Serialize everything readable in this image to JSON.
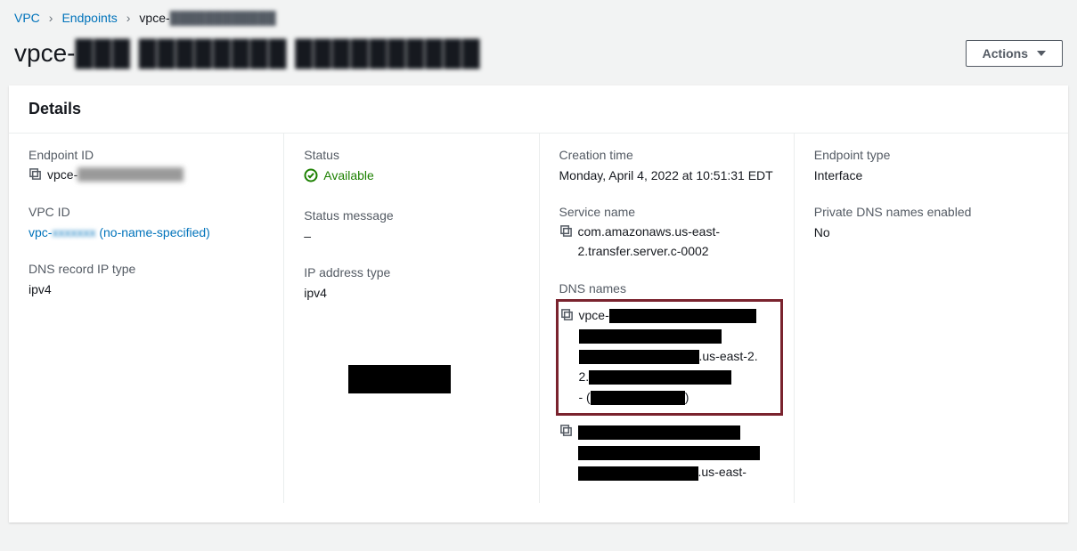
{
  "breadcrumb": {
    "vpc": "VPC",
    "endpoints": "Endpoints",
    "current_prefix": "vpce-",
    "current_redacted": "████████████"
  },
  "page": {
    "title_prefix": "vpce-",
    "title_redacted": "███ ████████ ██████████"
  },
  "actions_label": "Actions",
  "card": {
    "title": "Details"
  },
  "col1": {
    "endpoint_id_label": "Endpoint ID",
    "endpoint_id_prefix": "vpce-",
    "vpc_id_label": "VPC ID",
    "vpc_id_prefix": "vpc-",
    "vpc_id_suffix": " (no-name-specified)",
    "dns_record_ip_type_label": "DNS record IP type",
    "dns_record_ip_type": "ipv4"
  },
  "col2": {
    "status_label": "Status",
    "status_value": "Available",
    "status_message_label": "Status message",
    "status_message": "–",
    "ip_address_type_label": "IP address type",
    "ip_address_type": "ipv4"
  },
  "col3": {
    "creation_time_label": "Creation time",
    "creation_time": "Monday, April 4, 2022 at 10:51:31 EDT",
    "service_name_label": "Service name",
    "service_name": "com.amazonaws.us-east-2.transfer.server.c-0002",
    "dns_names_label": "DNS names",
    "dns1_prefix": "vpce-",
    "dns1_mid": ".us-east-2.",
    "dns1_suffix": " - (",
    "dns1_close": ")",
    "dns2_suffix": ".us-east-"
  },
  "col4": {
    "endpoint_type_label": "Endpoint type",
    "endpoint_type": "Interface",
    "private_dns_label": "Private DNS names enabled",
    "private_dns_value": "No"
  }
}
